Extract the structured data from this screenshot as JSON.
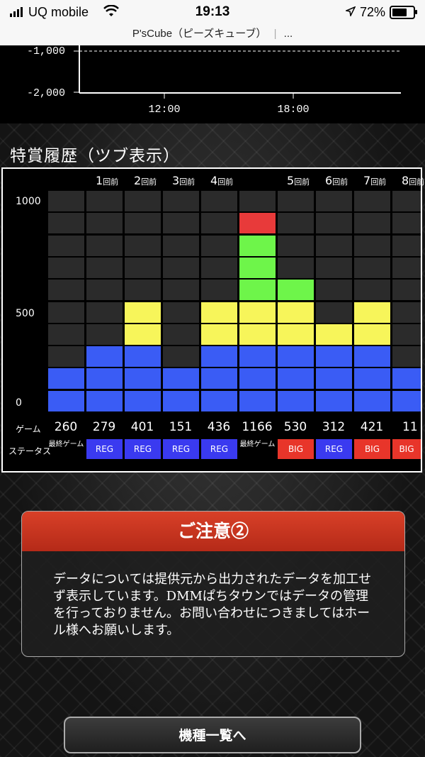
{
  "status_bar": {
    "carrier": "UQ mobile",
    "time": "19:13",
    "battery": "72%",
    "battery_level": 0.72
  },
  "url_bar": {
    "title": "P'sCube（ピーズキューブ）",
    "menu": "..."
  },
  "top_chart": {
    "y_ticks": [
      "-1,000",
      "-2,000"
    ],
    "x_ticks": [
      "12:00",
      "18:00"
    ]
  },
  "history": {
    "title": "特賞履歴（ツブ表示）",
    "y_labels": [
      "1000",
      "500",
      "0"
    ],
    "row_game_label": "ゲーム",
    "row_status_label": "ステータス",
    "columns": [
      {
        "header": "",
        "header_suffix": "",
        "game": "260",
        "status": "最終ゲーム",
        "status_type": "last",
        "bars": {
          "blue": 2,
          "yellow": 0,
          "green": 0,
          "red": 0
        }
      },
      {
        "header": "1",
        "header_suffix": "回前",
        "game": "279",
        "status": "REG",
        "status_type": "reg",
        "bars": {
          "blue": 3,
          "yellow": 0,
          "green": 0,
          "red": 0
        }
      },
      {
        "header": "2",
        "header_suffix": "回前",
        "game": "401",
        "status": "REG",
        "status_type": "reg",
        "bars": {
          "blue": 3,
          "yellow": 2,
          "green": 0,
          "red": 0
        }
      },
      {
        "header": "3",
        "header_suffix": "回前",
        "game": "151",
        "status": "REG",
        "status_type": "reg",
        "bars": {
          "blue": 2,
          "yellow": 0,
          "green": 0,
          "red": 0
        }
      },
      {
        "header": "4",
        "header_suffix": "回前",
        "game": "436",
        "status": "REG",
        "status_type": "reg",
        "bars": {
          "blue": 3,
          "yellow": 2,
          "green": 0,
          "red": 0
        }
      },
      {
        "header": "",
        "header_suffix": "",
        "game": "1166",
        "status": "最終ゲーム",
        "status_type": "last",
        "bars": {
          "blue": 3,
          "yellow": 2,
          "green": 3,
          "red": 1
        }
      },
      {
        "header": "5",
        "header_suffix": "回前",
        "game": "530",
        "status": "BIG",
        "status_type": "big",
        "bars": {
          "blue": 3,
          "yellow": 2,
          "green": 1,
          "red": 0
        }
      },
      {
        "header": "6",
        "header_suffix": "回前",
        "game": "312",
        "status": "REG",
        "status_type": "reg",
        "bars": {
          "blue": 3,
          "yellow": 1,
          "green": 0,
          "red": 0
        }
      },
      {
        "header": "7",
        "header_suffix": "回前",
        "game": "421",
        "status": "BIG",
        "status_type": "big",
        "bars": {
          "blue": 3,
          "yellow": 2,
          "green": 0,
          "red": 0
        }
      },
      {
        "header": "8",
        "header_suffix": "回前",
        "game": "11",
        "status": "BIG",
        "status_type": "big",
        "bars": {
          "blue": 2,
          "yellow": 0,
          "green": 0,
          "red": 0
        }
      }
    ]
  },
  "colors": {
    "blue": "#3a5cf5",
    "yellow": "#f7f55a",
    "green": "#6ef54a",
    "red": "#e83a3a",
    "reg": "#3a3af0",
    "big": "#e8352a",
    "empty": "#2b2b2b"
  },
  "notice": {
    "title": "ご注意②",
    "body": "データについては提供元から出力されたデータを加工せず表示しています。DMMぱちタウンではデータの管理を行っておりません。お問い合わせにつきましてはホール様へお願いします。"
  },
  "button": {
    "label": "機種一覧へ"
  }
}
